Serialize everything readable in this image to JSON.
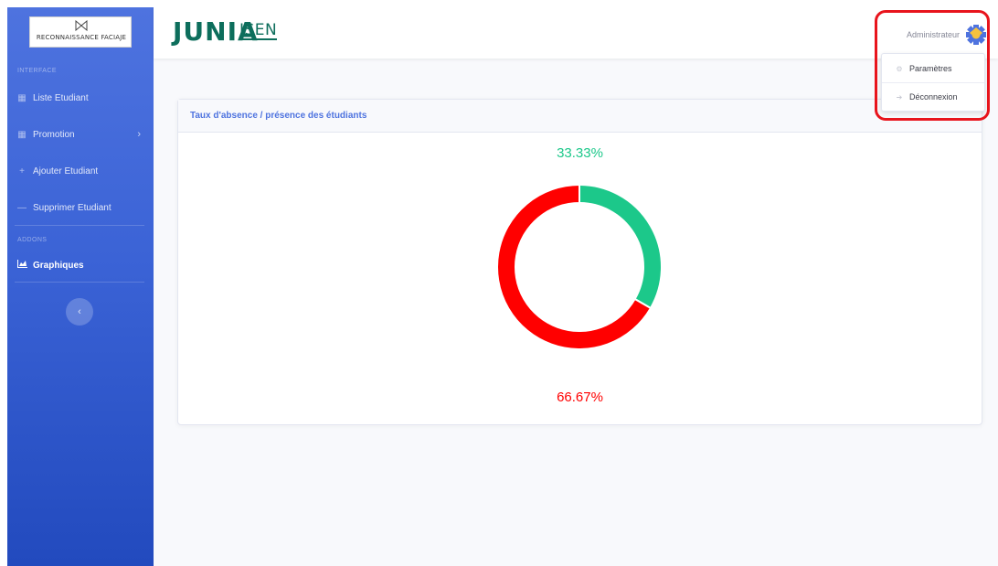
{
  "brand": {
    "text": "RECONNAISSANCE FACIAJE"
  },
  "sidebar": {
    "sections": [
      {
        "heading": "INTERFACE"
      },
      {
        "heading": "ADDONS"
      }
    ],
    "items": [
      {
        "label": "Liste Etudiant",
        "icon": "table-icon"
      },
      {
        "label": "Promotion",
        "icon": "table-icon",
        "chevron": "›"
      },
      {
        "label": "Ajouter Etudiant",
        "icon": "plus-icon"
      },
      {
        "label": "Supprimer Etudiant",
        "icon": "minus-icon"
      },
      {
        "label": "Graphiques",
        "icon": "chart-area-icon",
        "active": true
      }
    ],
    "toggle": "‹"
  },
  "topbar": {
    "logo_primary": "JUNIA",
    "logo_secondary": "ISEN",
    "user_name": "Administrateur"
  },
  "user_menu": {
    "items": [
      {
        "label": "Paramètres",
        "icon": "cogs-icon"
      },
      {
        "label": "Déconnexion",
        "icon": "sign-out-icon"
      }
    ]
  },
  "card": {
    "title": "Taux d'absence / présence des étudiants"
  },
  "colors": {
    "presence": "#1cc88a",
    "absence": "#ff0000",
    "accent": "#4e73df",
    "highlight": "#e8141c"
  },
  "chart_data": {
    "type": "pie",
    "variant": "doughnut",
    "labels": [
      "33.33%",
      "66.67%"
    ],
    "values": [
      33.33,
      66.67
    ],
    "colors": [
      "#1cc88a",
      "#ff0000"
    ]
  }
}
